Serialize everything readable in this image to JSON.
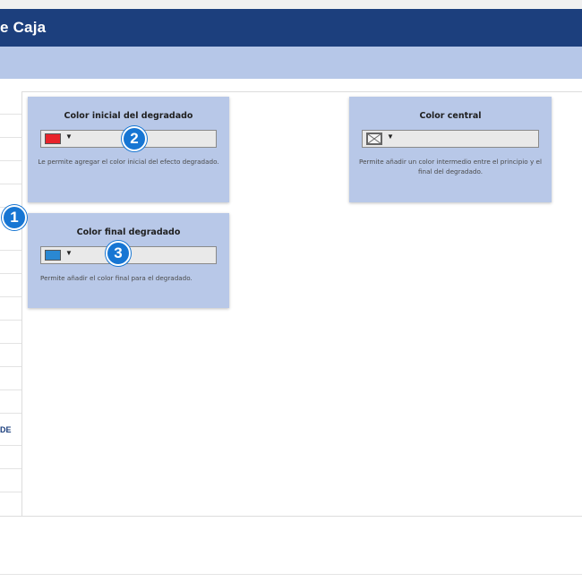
{
  "header": {
    "title": "e Caja"
  },
  "sidebar": {
    "items": [
      "",
      "",
      "",
      "",
      "",
      "",
      "",
      "",
      "",
      "",
      "",
      "",
      "",
      "",
      "",
      "DE",
      "",
      ""
    ]
  },
  "cards": {
    "start": {
      "title": "Color inicial del degradado",
      "caret": "▼",
      "swatch_color": "#e8242b",
      "description": "Le permite agregar el color inicial del efecto degradado."
    },
    "center": {
      "title": "Color central",
      "caret": "▼",
      "swatch_icon": "no-color-icon",
      "description": "Permite añadir un color intermedio entre el principio y el final del degradado."
    },
    "end": {
      "title": "Color final degradado",
      "caret": "▼",
      "swatch_color": "#2a88d2",
      "description": "Permite añadir el color final para el degradado."
    }
  },
  "badges": {
    "one": "1",
    "two": "2",
    "three": "3"
  },
  "colors": {
    "header": "#1c3f7d",
    "subheader": "#b6c7e8",
    "card": "#b8c8e8",
    "badge": "#1776d3"
  }
}
